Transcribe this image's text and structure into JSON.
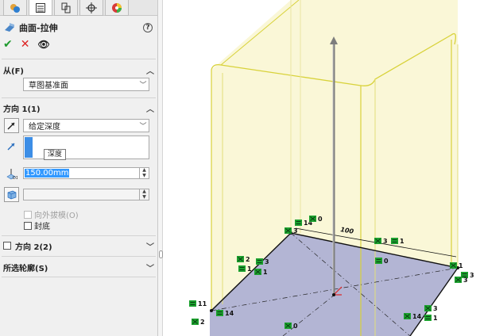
{
  "tabs": [
    {
      "name": "feature-manager-icon"
    },
    {
      "name": "property-manager-icon"
    },
    {
      "name": "configuration-manager-icon"
    },
    {
      "name": "dimxpert-icon"
    },
    {
      "name": "display-manager-icon"
    }
  ],
  "feature": {
    "title": "曲面-拉伸",
    "help": "?"
  },
  "actions": {
    "ok": "✔",
    "cancel": "✕",
    "preview": "👁"
  },
  "from": {
    "header": "从(F)",
    "value": "草图基准面"
  },
  "direction1": {
    "header": "方向 1(1)",
    "end_condition": "给定深度",
    "depth_tooltip": "深度",
    "depth_value": "150.00mm",
    "draft_value": "",
    "draft_outward_label": "向外拔模(O)",
    "cap_ends_label": "封底"
  },
  "direction2": {
    "header": "方向 2(2)"
  },
  "selected_contours": {
    "header": "所选轮廓(S)"
  },
  "viewport": {
    "dimension_label": "100",
    "relations": [
      "11",
      "2",
      "14",
      "0",
      "2",
      "1",
      "3",
      "1",
      "3",
      "14",
      "0",
      "3",
      "1",
      "0",
      "1",
      "3",
      "3",
      "14",
      "1",
      "3"
    ]
  },
  "colors": {
    "surface": "#f5f0b0",
    "edge": "#d8d23a",
    "plane": "#9a9cc8",
    "relation_bg": "#1ba12e",
    "accent_blue": "#3d8ee6"
  }
}
